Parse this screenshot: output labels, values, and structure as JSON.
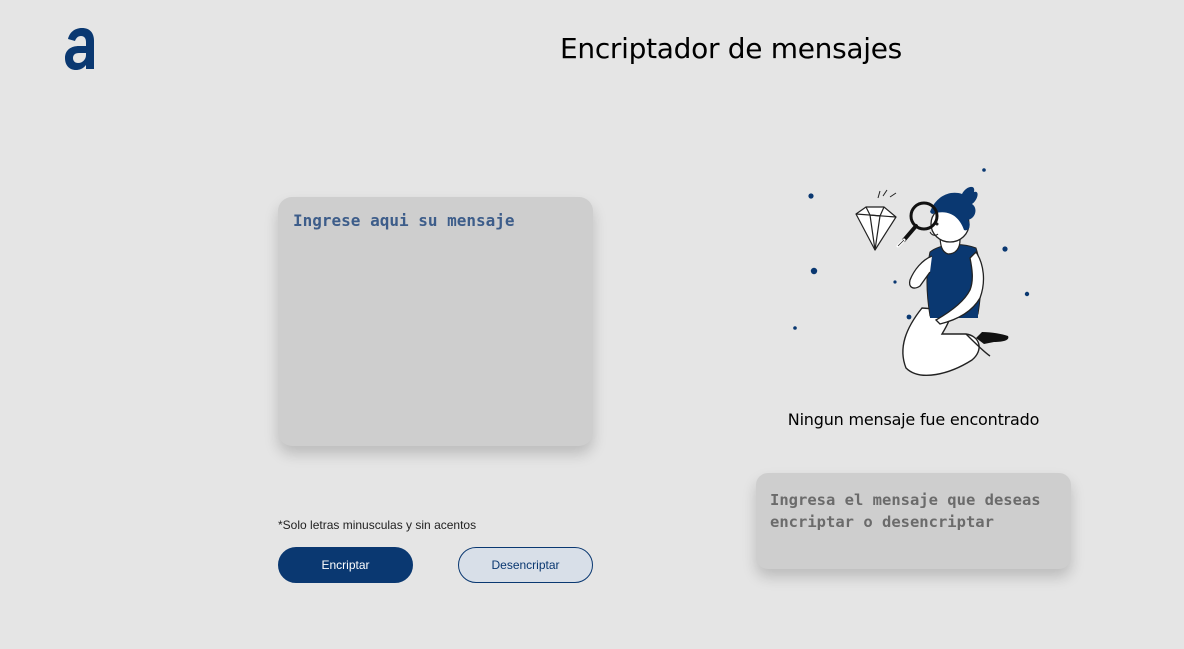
{
  "header": {
    "logo_icon": "alura-logo-icon",
    "title": "Encriptador de mensajes"
  },
  "input": {
    "placeholder": "Ingrese aqui su mensaje",
    "value": ""
  },
  "hint": {
    "text": "*Solo letras minusculas y sin acentos"
  },
  "buttons": {
    "encrypt_label": "Encriptar",
    "decrypt_label": "Desencriptar"
  },
  "output": {
    "illustration_icon": "search-person-diamond-illustration",
    "empty_title": "Ningun mensaje fue encontrado",
    "empty_text": "Ingresa el mensaje que deseas encriptar o desencriptar"
  },
  "colors": {
    "background": "#e5e5e5",
    "primary": "#0a3871",
    "box": "#cecece"
  }
}
